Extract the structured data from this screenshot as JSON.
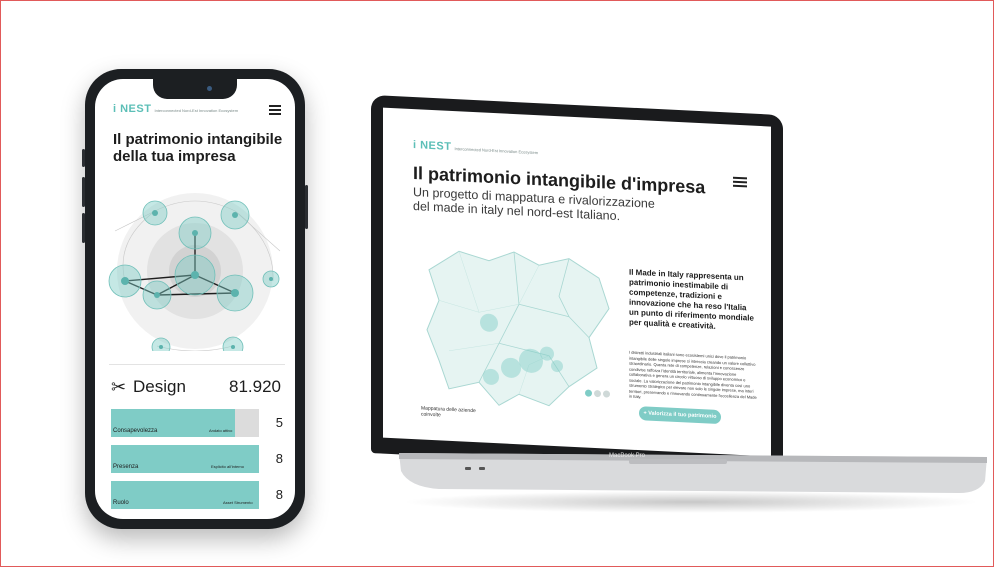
{
  "accent": "#7fccc6",
  "phone": {
    "logo": "i NEST",
    "logo_tagline": "Interconnected Nord-Est Innovation Ecosystem",
    "title": "Il patrimonio intangibile della tua impresa",
    "design_label": "Design",
    "design_value": "81.920",
    "bars": [
      {
        "label": "Consapevolezza",
        "sub": "Andato attivo",
        "value": "5",
        "fill": 0.84
      },
      {
        "label": "Presenza",
        "sub": "Esplicito all'interno",
        "value": "8",
        "fill": 1.0
      },
      {
        "label": "Ruolo",
        "sub": "Asset Strumento",
        "value": "8",
        "fill": 1.0
      }
    ]
  },
  "laptop": {
    "logo": "i NEST",
    "logo_tagline": "Interconnected Nord-Est Innovation Ecosystem",
    "title": "Il patrimonio intangibile d'impresa",
    "subtitle": "Un progetto di mappatura e rivalorizzazione del made in italy nel nord-est Italiano.",
    "lead": "Il Made in Italy rappresenta un patrimonio inestimabile di competenze, tradizioni e innovazione che ha reso l'Italia un punto di riferimento mondiale per qualità e creatività.",
    "body": "I distretti industriali italiani sono ecosistemi unici dove il patrimonio intangibile delle singole imprese si intreccia creando un valore collettivo straordinario. Questa rete di competenze, relazioni e conoscenze condivise rafforza l'identità territoriale, alimenta l'innovazione collaborativa e genera un circolo virtuoso di sviluppo economico e sociale. La valorizzazione del patrimonio intangibile diventa così uno strumento strategico per elevare non solo le singole imprese, ma interi territori, preservando e rinnovando continuamente l'eccellenza del Made in Italy.",
    "map_caption": "Mappatura delle aziende coinvolte",
    "cta": "+ Valorizza il tuo patrimonio",
    "brand": "MacBook Pro"
  }
}
